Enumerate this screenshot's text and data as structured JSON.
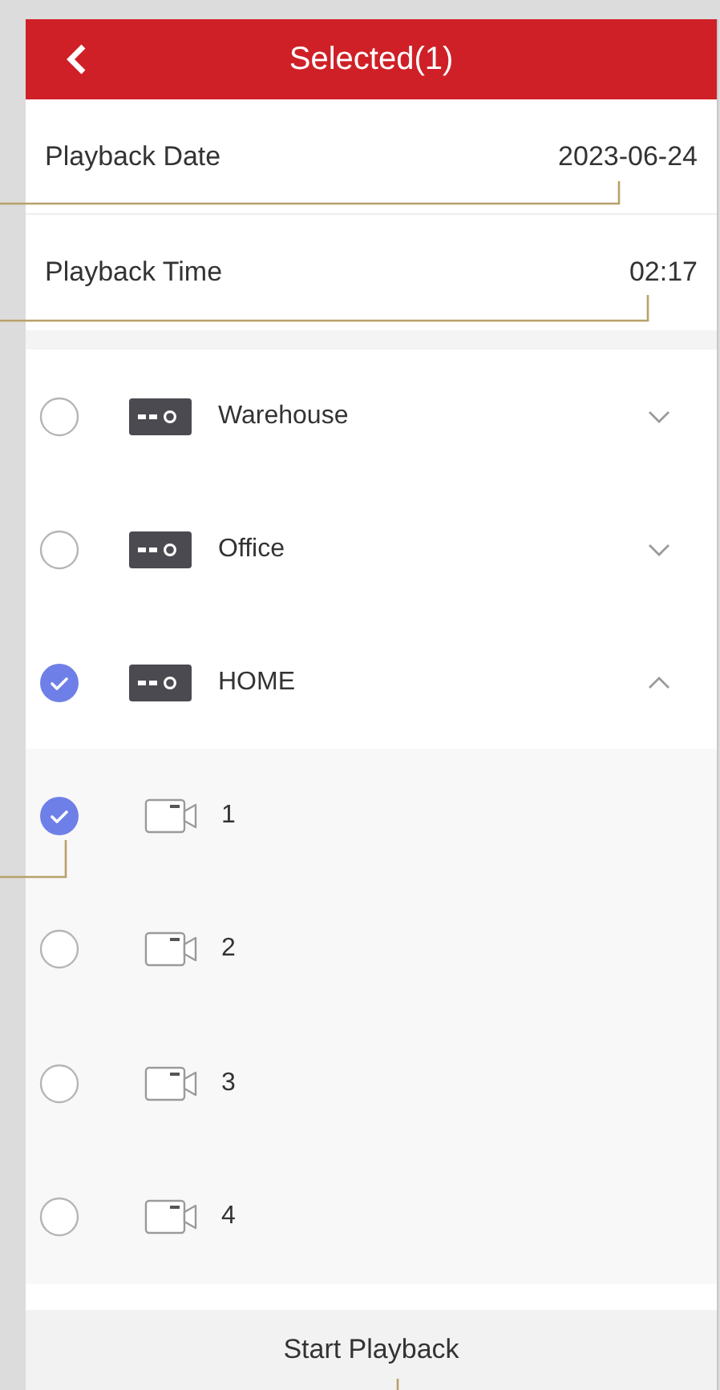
{
  "header": {
    "title": "Selected(1)"
  },
  "settings": [
    {
      "label": "Playback Date",
      "value": "2023-06-24"
    },
    {
      "label": "Playback Time",
      "value": "02:17"
    }
  ],
  "devices": [
    {
      "name": "Warehouse",
      "checked": false,
      "expanded": false
    },
    {
      "name": "Office",
      "checked": false,
      "expanded": false
    },
    {
      "name": "HOME",
      "checked": true,
      "expanded": true,
      "children": [
        {
          "name": "1",
          "checked": true
        },
        {
          "name": "2",
          "checked": false
        },
        {
          "name": "3",
          "checked": false
        },
        {
          "name": "4",
          "checked": false
        }
      ]
    }
  ],
  "footer": {
    "button": "Start Playback"
  }
}
